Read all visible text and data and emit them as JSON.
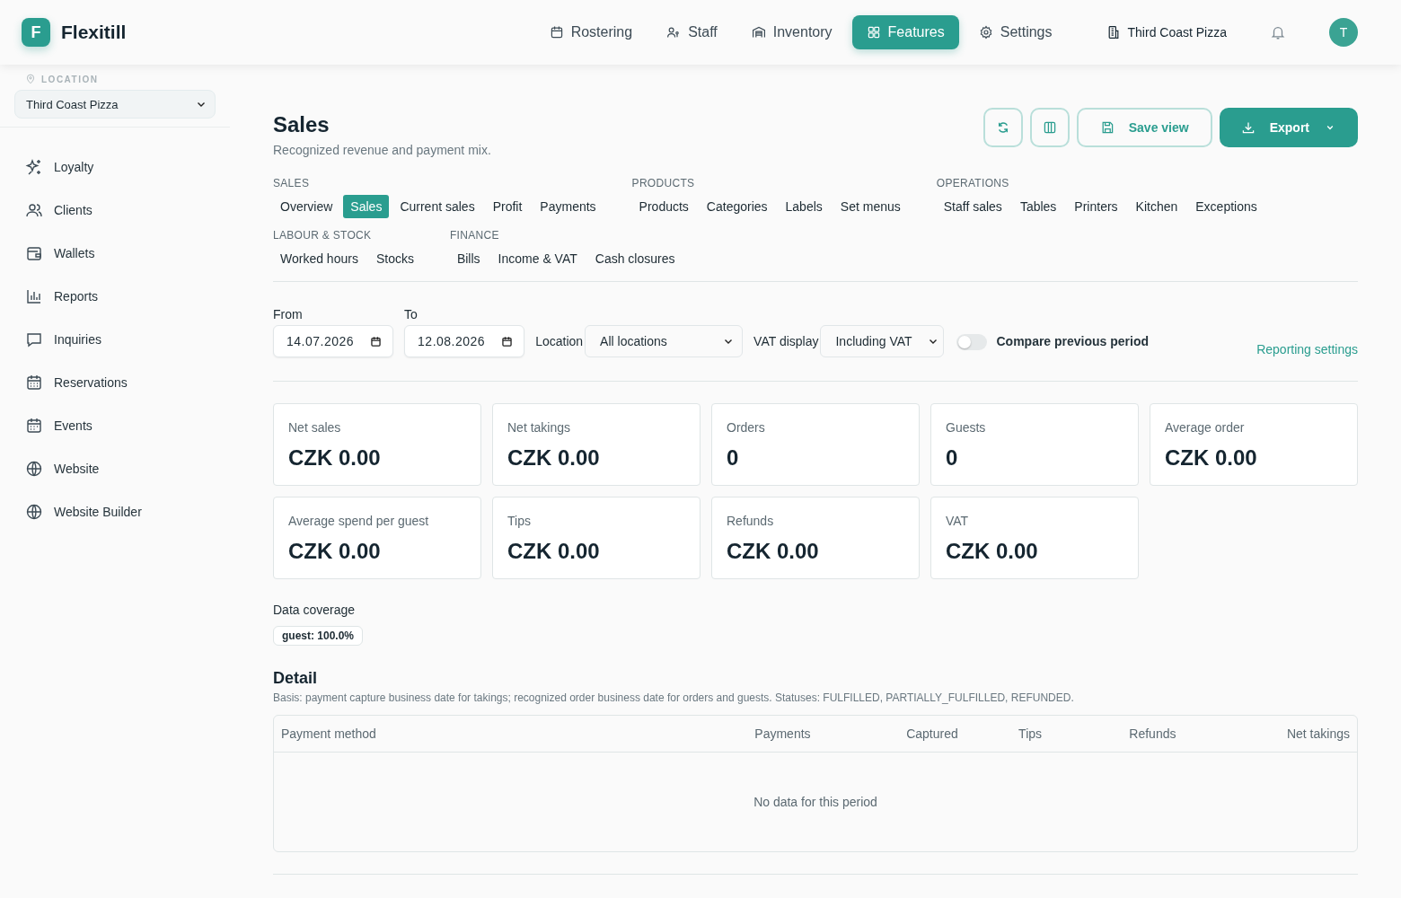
{
  "app": {
    "logo_letter": "F",
    "name": "Flexitill"
  },
  "top_nav": [
    {
      "label": "Rostering",
      "selected": false
    },
    {
      "label": "Staff",
      "selected": false
    },
    {
      "label": "Inventory",
      "selected": false
    },
    {
      "label": "Features",
      "selected": true
    },
    {
      "label": "Settings",
      "selected": false
    }
  ],
  "venue": "Third Coast Pizza",
  "avatar": "T",
  "sidebar": {
    "location_label": "LOCATION",
    "location_value": "Third Coast Pizza",
    "items": [
      {
        "label": "Loyalty"
      },
      {
        "label": "Clients"
      },
      {
        "label": "Wallets"
      },
      {
        "label": "Reports"
      },
      {
        "label": "Inquiries"
      },
      {
        "label": "Reservations"
      },
      {
        "label": "Events"
      },
      {
        "label": "Website"
      },
      {
        "label": "Website Builder"
      }
    ]
  },
  "page": {
    "title": "Sales",
    "subtitle": "Recognized revenue and payment mix.",
    "save_view": "Save view",
    "export": "Export"
  },
  "report_menu": [
    {
      "groups": [
        {
          "heading": "SALES",
          "items": [
            {
              "label": "Overview",
              "selected": false
            },
            {
              "label": "Sales",
              "selected": true
            },
            {
              "label": "Current sales",
              "selected": false
            },
            {
              "label": "Profit",
              "selected": false
            },
            {
              "label": "Payments",
              "selected": false
            }
          ]
        },
        {
          "heading": "PRODUCTS",
          "items": [
            {
              "label": "Products",
              "selected": false
            },
            {
              "label": "Categories",
              "selected": false
            },
            {
              "label": "Labels",
              "selected": false
            },
            {
              "label": "Set menus",
              "selected": false
            }
          ]
        },
        {
          "heading": "OPERATIONS",
          "items": [
            {
              "label": "Staff sales",
              "selected": false
            },
            {
              "label": "Tables",
              "selected": false
            },
            {
              "label": "Printers",
              "selected": false
            },
            {
              "label": "Kitchen",
              "selected": false
            },
            {
              "label": "Exceptions",
              "selected": false
            }
          ]
        }
      ]
    },
    {
      "groups": [
        {
          "heading": "LABOUR & STOCK",
          "items": [
            {
              "label": "Worked hours",
              "selected": false
            },
            {
              "label": "Stocks",
              "selected": false
            }
          ]
        },
        {
          "heading": "FINANCE",
          "items": [
            {
              "label": "Bills",
              "selected": false
            },
            {
              "label": "Income & VAT",
              "selected": false
            },
            {
              "label": "Cash closures",
              "selected": false
            }
          ]
        }
      ]
    }
  ],
  "filters": {
    "from": {
      "label": "From",
      "value": "14.07.2026"
    },
    "to": {
      "label": "To",
      "value": "12.08.2026"
    },
    "location": {
      "label": "Location",
      "value": "All locations"
    },
    "vat": {
      "label": "VAT display",
      "value": "Including VAT"
    },
    "compare": {
      "label": "Compare previous period",
      "on": false
    },
    "settings_link": "Reporting settings"
  },
  "kpis": [
    {
      "label": "Net sales",
      "value": "CZK 0.00"
    },
    {
      "label": "Net takings",
      "value": "CZK 0.00"
    },
    {
      "label": "Orders",
      "value": "0"
    },
    {
      "label": "Guests",
      "value": "0"
    },
    {
      "label": "Average order",
      "value": "CZK 0.00"
    },
    {
      "label": "Average spend per guest",
      "value": "CZK 0.00"
    },
    {
      "label": "Tips",
      "value": "CZK 0.00"
    },
    {
      "label": "Refunds",
      "value": "CZK 0.00"
    },
    {
      "label": "VAT",
      "value": "CZK 0.00"
    }
  ],
  "coverage": {
    "title": "Data coverage",
    "chips": [
      "guest: 100.0%"
    ]
  },
  "detail": {
    "title": "Detail",
    "note": "Basis: payment capture business date for takings; recognized order business date for orders and guests. Statuses: FULFILLED, PARTIALLY_FULFILLED, REFUNDED.",
    "columns": [
      "Payment method",
      "Payments",
      "Captured",
      "Tips",
      "Refunds",
      "Net takings"
    ],
    "empty": "No data for this period"
  }
}
